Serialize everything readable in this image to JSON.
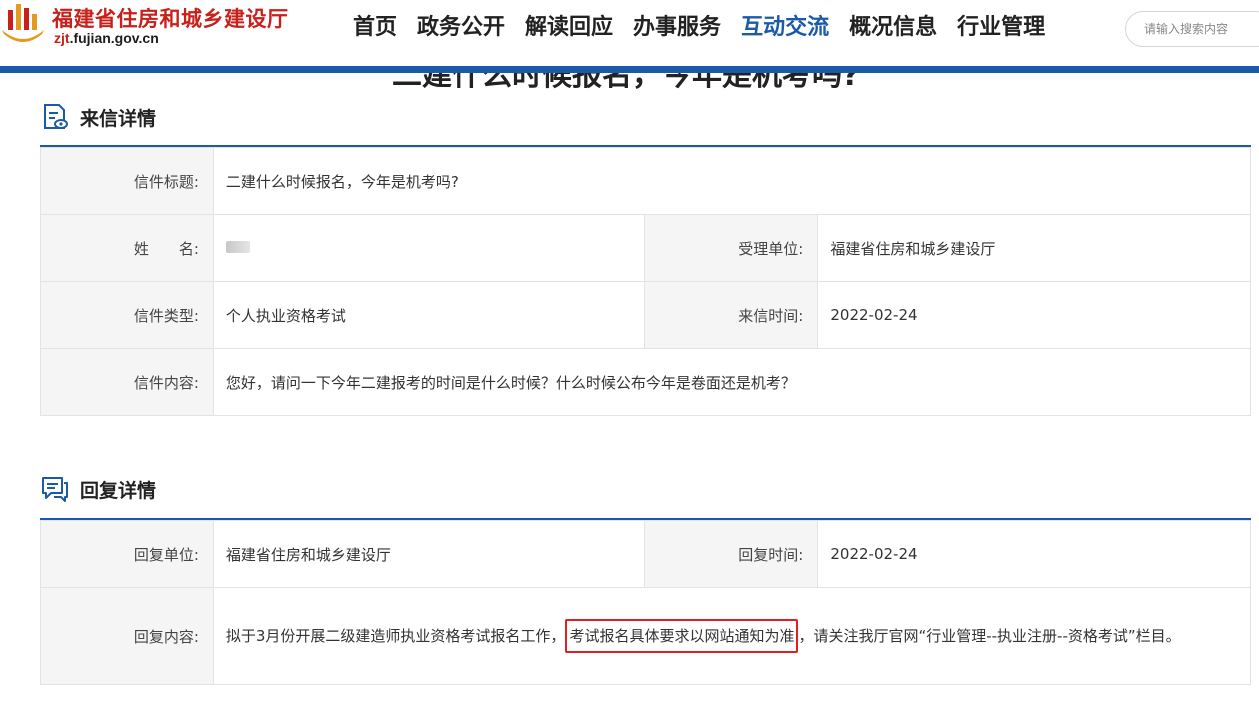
{
  "header": {
    "site_name": "福建省住房和城乡建设厅",
    "site_url_prefix": "zjt",
    "site_url_rest": ".fujian.gov.cn",
    "search_placeholder": "请输入搜索内容"
  },
  "nav": {
    "items": [
      {
        "label": "首页",
        "active": false
      },
      {
        "label": "政务公开",
        "active": false
      },
      {
        "label": "解读回应",
        "active": false
      },
      {
        "label": "办事服务",
        "active": false
      },
      {
        "label": "互动交流",
        "active": true
      },
      {
        "label": "概况信息",
        "active": false
      },
      {
        "label": "行业管理",
        "active": false
      }
    ]
  },
  "page_title": "二建什么时候报名，今年是机考吗?",
  "letter": {
    "section_title": "来信详情",
    "title_label": "信件标题:",
    "title_value": "二建什么时候报名，今年是机考吗?",
    "name_label": "姓　　名:",
    "dept_label": "受理单位:",
    "dept_value": "福建省住房和城乡建设厅",
    "type_label": "信件类型:",
    "type_value": "个人执业资格考试",
    "time_label": "来信时间:",
    "time_value": "2022-02-24",
    "content_label": "信件内容:",
    "content_value": "您好，请问一下今年二建报考的时间是什么时候？什么时候公布今年是卷面还是机考？"
  },
  "reply": {
    "section_title": "回复详情",
    "dept_label": "回复单位:",
    "dept_value": "福建省住房和城乡建设厅",
    "time_label": "回复时间:",
    "time_value": "2022-02-24",
    "content_label": "回复内容:",
    "content_part1": "拟于3月份开展二级建造师执业资格考试报名工作，",
    "content_highlight": "考试报名具体要求以网站通知为准",
    "content_part2": "，请关注我厅官网“行业管理--执业注册--资格考试”栏目。"
  },
  "colors": {
    "brand_blue": "#1a5aa8",
    "brand_red": "#c8201a",
    "highlight_border": "#e02020"
  },
  "icons": {
    "logo": "building-columns-logo",
    "letter_section": "document-eye-icon",
    "reply_section": "chat-bubble-icon"
  }
}
